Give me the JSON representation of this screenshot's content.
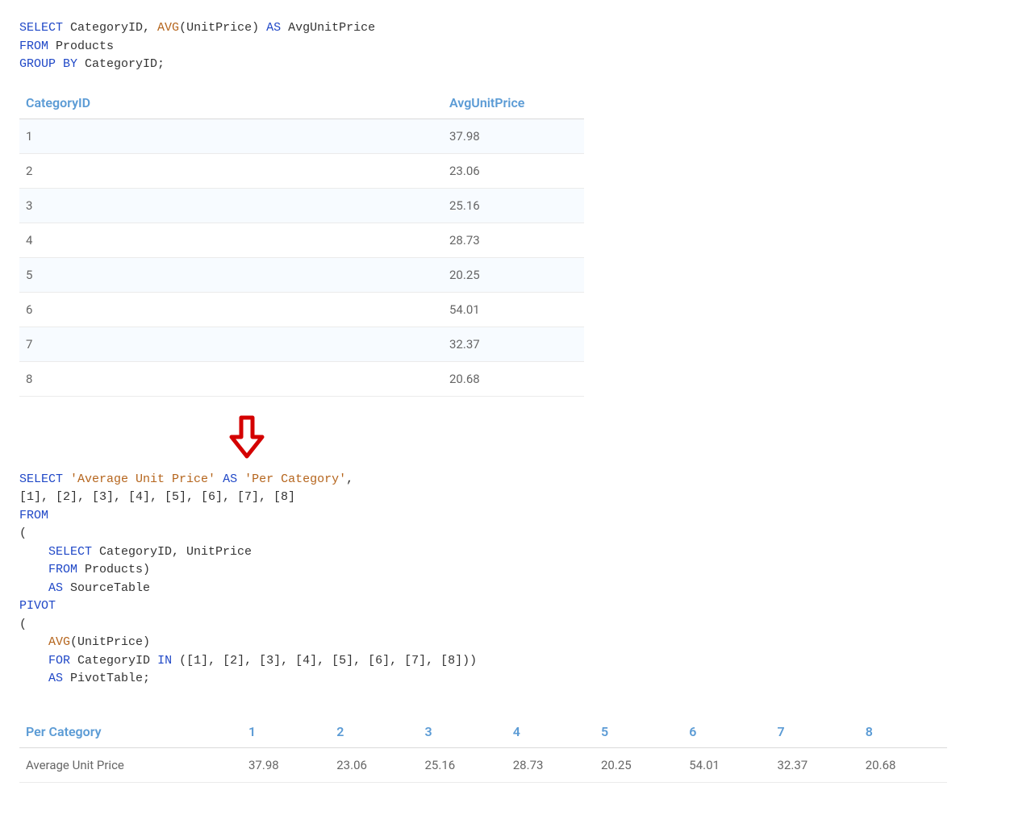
{
  "sql1": {
    "l1": {
      "select": "SELECT",
      "cols": " CategoryID, ",
      "avg": "AVG",
      "unitprice": "(UnitPrice) ",
      "as": "AS",
      "alias": " AvgUnitPrice"
    },
    "l2": {
      "from": "FROM",
      "tbl": " Products"
    },
    "l3": {
      "group": "GROUP BY",
      "col": " CategoryID;"
    }
  },
  "table1": {
    "headers": [
      "CategoryID",
      "AvgUnitPrice"
    ],
    "rows": [
      [
        "1",
        "37.98"
      ],
      [
        "2",
        "23.06"
      ],
      [
        "3",
        "25.16"
      ],
      [
        "4",
        "28.73"
      ],
      [
        "5",
        "20.25"
      ],
      [
        "6",
        "54.01"
      ],
      [
        "7",
        "32.37"
      ],
      [
        "8",
        "20.68"
      ]
    ]
  },
  "sql2": {
    "l1": {
      "select": "SELECT ",
      "str1": "'Average Unit Price'",
      "sp1": " ",
      "as": "AS",
      "sp2": " ",
      "str2": "'Per Category'",
      "comma": ","
    },
    "l2": "[1], [2], [3], [4], [5], [6], [7], [8]",
    "l3": "FROM",
    "l4": "(",
    "l5": {
      "indent": "    ",
      "select": "SELECT",
      "cols": " CategoryID, UnitPrice"
    },
    "l6": {
      "indent": "    ",
      "from": "FROM",
      "tbl": " Products)"
    },
    "l7": {
      "indent": "    ",
      "as": "AS",
      "name": " SourceTable"
    },
    "l8": "PIVOT",
    "l9": "(",
    "l10": {
      "indent": "    ",
      "avg": "AVG",
      "arg": "(UnitPrice)"
    },
    "l11": {
      "indent": "    ",
      "for": "FOR",
      "mid": " CategoryID ",
      "in": "IN",
      "list": " ([1], [2], [3], [4], [5], [6], [7], [8]))"
    },
    "l12": {
      "indent": "    ",
      "as": "AS",
      "name": " PivotTable;"
    }
  },
  "table2": {
    "headers": [
      "Per Category",
      "1",
      "2",
      "3",
      "4",
      "5",
      "6",
      "7",
      "8"
    ],
    "rows": [
      [
        "Average Unit Price",
        "37.98",
        "23.06",
        "25.16",
        "28.73",
        "20.25",
        "54.01",
        "32.37",
        "20.68"
      ]
    ]
  }
}
